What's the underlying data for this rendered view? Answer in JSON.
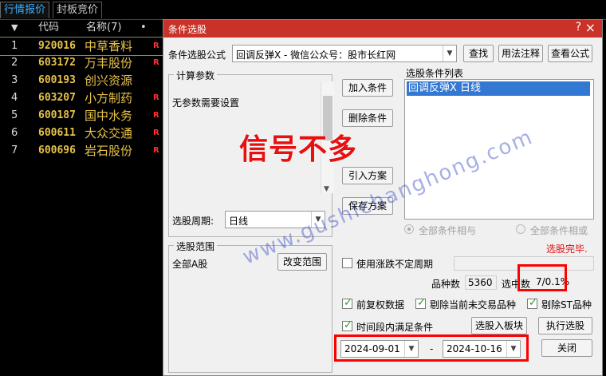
{
  "tabs": [
    "行情报价",
    "封板竞价"
  ],
  "list_header": {
    "sort_mark": "▼",
    "code": "代码",
    "name": "名称(7)",
    "dot": "•"
  },
  "rows": [
    {
      "idx": "1",
      "code": "920016",
      "name": "中草香料",
      "flag": "R"
    },
    {
      "idx": "2",
      "code": "603172",
      "name": "万丰股份",
      "flag": "R"
    },
    {
      "idx": "3",
      "code": "600193",
      "name": "创兴资源",
      "flag": ""
    },
    {
      "idx": "4",
      "code": "603207",
      "name": "小方制药",
      "flag": "R"
    },
    {
      "idx": "5",
      "code": "600187",
      "name": "国中水务",
      "flag": "R"
    },
    {
      "idx": "6",
      "code": "600611",
      "name": "大众交通",
      "flag": "R"
    },
    {
      "idx": "7",
      "code": "600696",
      "name": "岩石股份",
      "flag": "R"
    }
  ],
  "dialog": {
    "title": "条件选股",
    "help": "?",
    "close": "×",
    "formula_label": "条件选股公式",
    "formula_value": "回调反弹X - 微信公众号：股市长红网",
    "btn_find": "查找",
    "btn_usage": "用法注释",
    "btn_view": "查看公式",
    "params_group": "计算参数",
    "params_text": "无参数需要设置",
    "btn_add": "加入条件",
    "btn_delete": "删除条件",
    "btn_import": "引入方案",
    "btn_save": "保存方案",
    "cond_list_label": "选股条件列表",
    "cond_items": [
      "回调反弹X  日线"
    ],
    "period_label": "选股周期:",
    "period_value": "日线",
    "radio_and": "全部条件相与",
    "radio_or": "全部条件相或",
    "status": "选股完毕.",
    "range_group": "选股范围",
    "range_value": "全部A股",
    "btn_change_range": "改变范围",
    "chk_limit_period": "使用涨跌不定周期",
    "count_label": "品种数",
    "count_value": "5360",
    "selected_label": "选中数",
    "selected_value": "7/0.1%",
    "chk_adjusted": "前复权数据",
    "chk_exclude_untraded": "剔除当前未交易品种",
    "chk_exclude_st": "剔除ST品种",
    "chk_time_range": "时间段内满足条件",
    "btn_to_board": "选股入板块",
    "btn_execute": "执行选股",
    "date_start": "2024-09-01",
    "date_sep": "-",
    "date_end": "2024-10-16",
    "btn_close": "关闭"
  },
  "overlay_text": "信号不多",
  "watermark": "www.gushichanghong.com",
  "colors": {
    "title_bar": "#c83228",
    "highlight": "#ff0000",
    "selection": "#3379d4",
    "stock_text": "#e7c24a"
  }
}
